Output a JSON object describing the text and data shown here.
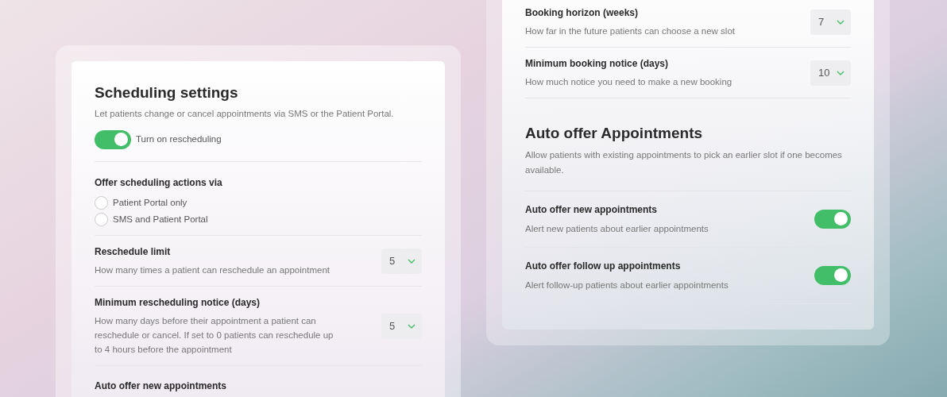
{
  "scheduling": {
    "title": "Scheduling settings",
    "subtitle": "Let patients change or cancel appointments via SMS or the Patient Portal.",
    "toggle": {
      "label": "Turn on rescheduling",
      "on": true
    },
    "offer_via": {
      "label": "Offer scheduling actions via",
      "options": [
        {
          "label": "Patient Portal only",
          "selected": false
        },
        {
          "label": "SMS and Patient Portal",
          "selected": false
        }
      ]
    },
    "settings": [
      {
        "title": "Reschedule limit",
        "description": "How many times a patient can reschedule an appointment",
        "value": "5"
      },
      {
        "title": "Minimum rescheduling notice (days)",
        "description": "How many days before their appointment a patient can reschedule or cancel. If set to 0 patients can reschedule up to 4 hours before the appointment",
        "value": "5"
      }
    ],
    "next_heading": "Auto offer new appointments"
  },
  "booking": {
    "settings": [
      {
        "title": "Booking horizon (weeks)",
        "description": "How far in the future patients can choose a new slot",
        "value": "7"
      },
      {
        "title": "Minimum booking notice (days)",
        "description": "How much notice you need to make a new booking",
        "value": "10"
      }
    ],
    "auto_offer": {
      "title": "Auto offer Appointments",
      "subtitle": "Allow patients with existing appointments to pick an earlier slot if one becomes available.",
      "items": [
        {
          "title": "Auto offer new appointments",
          "description": "Alert new patients about earlier appointments",
          "on": true
        },
        {
          "title": "Auto offer follow up appointments",
          "description": "Alert follow-up patients about earlier appointments",
          "on": true
        }
      ]
    }
  }
}
